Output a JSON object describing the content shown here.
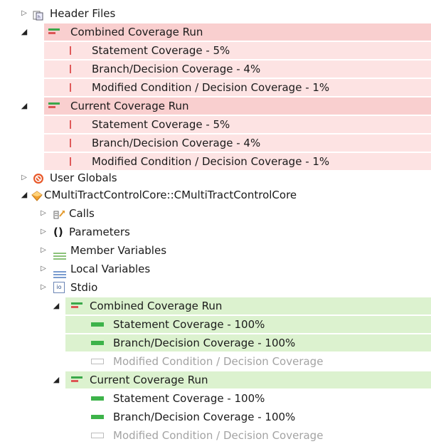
{
  "tree": {
    "header_files": "Header Files",
    "combined_run_1": {
      "label": "Combined Coverage Run",
      "items": [
        "Statement Coverage - 5%",
        "Branch/Decision Coverage - 4%",
        "Modified Condition / Decision Coverage - 1%"
      ]
    },
    "current_run_1": {
      "label": "Current Coverage Run",
      "items": [
        "Statement Coverage - 5%",
        "Branch/Decision Coverage - 4%",
        "Modified Condition / Decision Coverage - 1%"
      ]
    },
    "user_globals": "User Globals",
    "function_node": "CMultiTractControlCore::CMultiTractControlCore",
    "calls": "Calls",
    "parameters": "Parameters",
    "member_variables": "Member Variables",
    "local_variables": "Local Variables",
    "stdio": "Stdio",
    "combined_run_2": {
      "label": "Combined Coverage Run",
      "items": [
        "Statement Coverage - 100%",
        "Branch/Decision Coverage - 100%",
        "Modified Condition / Decision Coverage"
      ]
    },
    "current_run_2": {
      "label": "Current Coverage Run",
      "items": [
        "Statement Coverage - 100%",
        "Branch/Decision Coverage - 100%",
        "Modified Condition / Decision Coverage"
      ]
    }
  },
  "glyphs": {
    "collapsed": "▷",
    "expanded": "◢",
    "parameters_icon": "()",
    "stdio_icon": "io"
  },
  "colors": {
    "uncovered_highlight": "#fde3e3",
    "covered_highlight": "#dcf2cf",
    "covered_bar": "#3db34a"
  }
}
